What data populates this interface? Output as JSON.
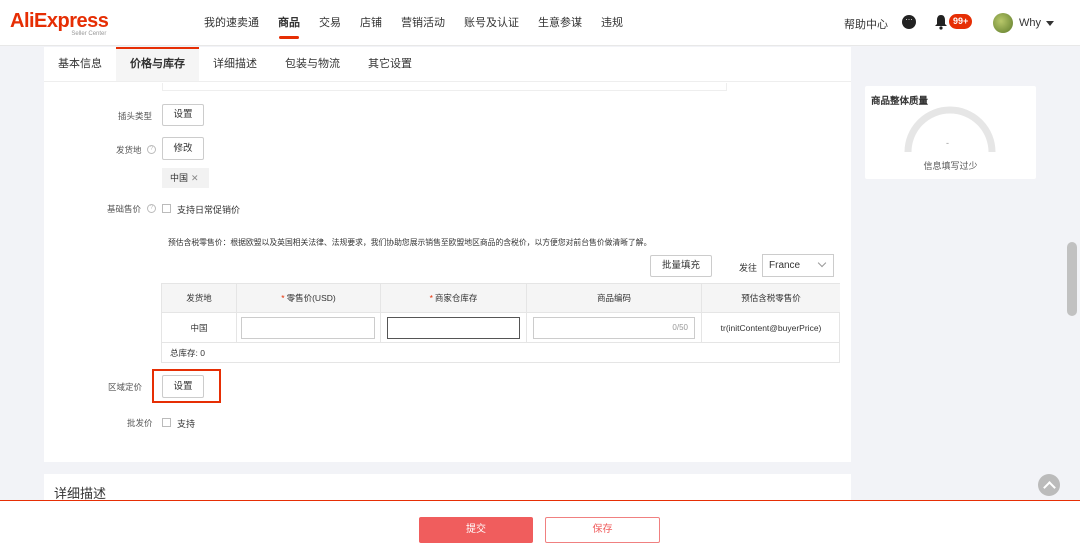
{
  "logo": {
    "brand": "AliExpress",
    "sub": "Seller Center"
  },
  "nav": {
    "items": [
      "我的速卖通",
      "商品",
      "交易",
      "店铺",
      "营销活动",
      "账号及认证",
      "生意参谋",
      "违规"
    ],
    "help": "帮助中心",
    "badge": "99+",
    "user": "Why"
  },
  "tabs": [
    "基本信息",
    "价格与库存",
    "详细描述",
    "包装与物流",
    "其它设置"
  ],
  "form": {
    "plug_type_label": "插头类型",
    "plug_type_button": "设置",
    "ship_from_label": "发货地",
    "ship_from_button": "修改",
    "ship_from_tag": "中国",
    "base_price_label": "基础售价",
    "base_price_checkbox": "支持日常促销价",
    "note": "预估含税零售价：根据欧盟以及英国相关法律、法规要求，我们协助您展示销售至欧盟地区商品的含税价，以方便您对前台售价做清晰了解。",
    "batch_fill": "批量填充",
    "ship_to_label": "发往",
    "ship_to_value": "France",
    "table": {
      "headers": [
        "发货地",
        "零售价(USD)",
        "商家仓库存",
        "商品编码",
        "预估含税零售价"
      ],
      "row": {
        "origin": "中国",
        "sku_counter": "0/50",
        "estimated": "tr(initContent@buyerPrice)"
      },
      "total": "总库存: 0"
    },
    "regional_price_label": "区域定价",
    "regional_price_button": "设置",
    "wholesale_label": "批发价",
    "wholesale_checkbox": "支持"
  },
  "description_title": "详细描述",
  "quality": {
    "title": "商品整体质量",
    "score": "-",
    "status": "信息填写过少"
  },
  "footer": {
    "submit": "提交",
    "save": "保存"
  },
  "colors": {
    "accent": "#e62e04",
    "submit_bg": "#f05d5d"
  }
}
